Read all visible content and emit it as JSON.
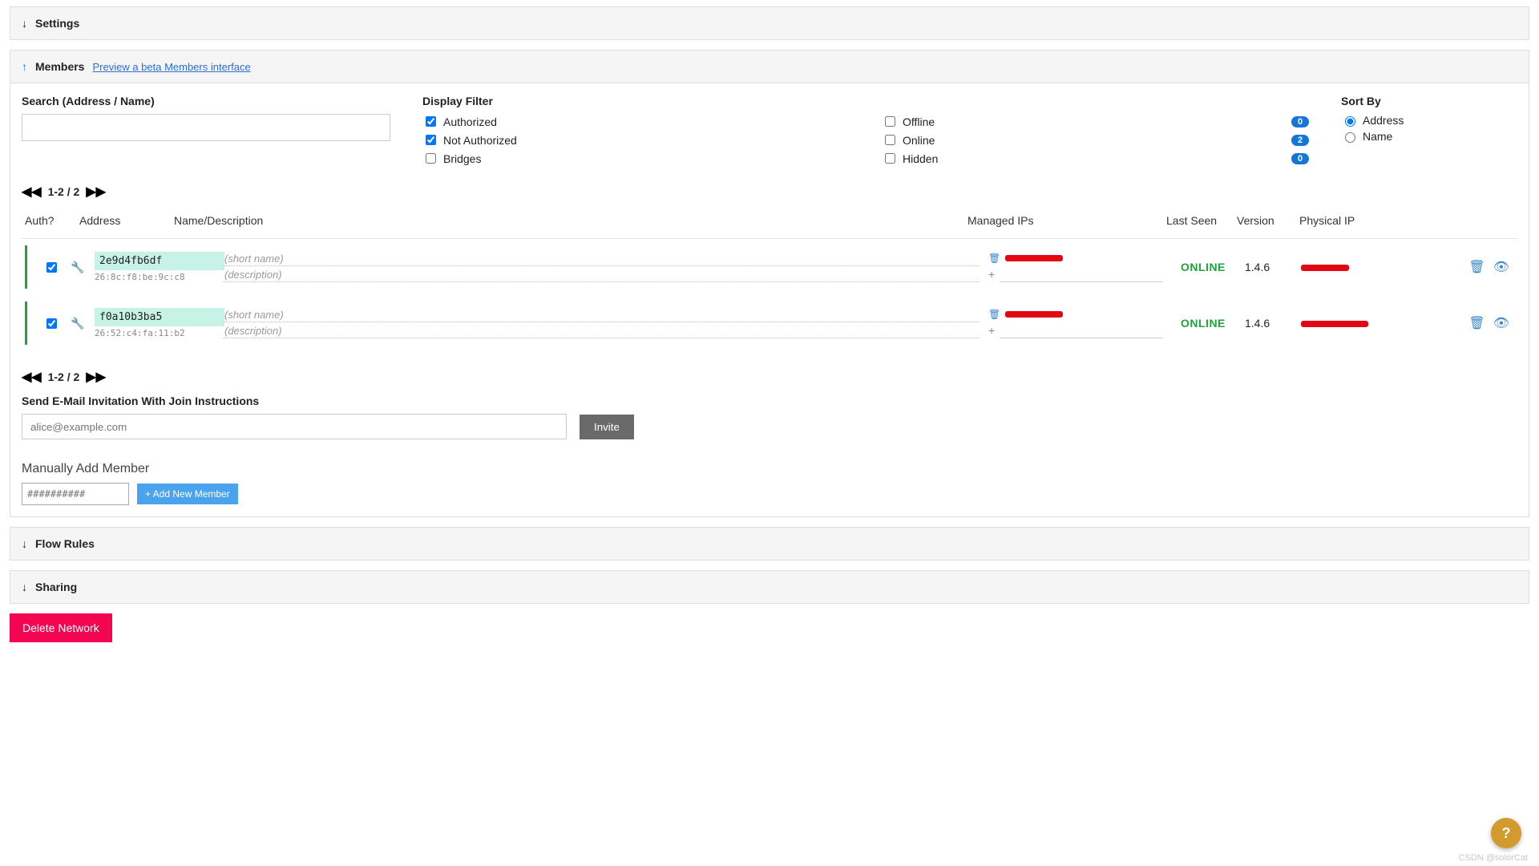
{
  "settings": {
    "title": "Settings"
  },
  "members": {
    "title": "Members",
    "betaLink": "Preview a beta Members interface",
    "searchLabel": "Search (Address / Name)",
    "displayLabel": "Display Filter",
    "sortLabel": "Sort By",
    "display": {
      "authorized": "Authorized",
      "notAuthorized": "Not Authorized",
      "bridges": "Bridges",
      "offline": "Offline",
      "online": "Online",
      "hidden": "Hidden",
      "offlineCount": "0",
      "onlineCount": "2",
      "hiddenCount": "0"
    },
    "sort": {
      "address": "Address",
      "name": "Name"
    },
    "pageRange": "1-2 / 2",
    "headers": {
      "auth": "Auth?",
      "address": "Address",
      "name": "Name/Description",
      "managed": "Managed IPs",
      "lastSeen": "Last Seen",
      "version": "Version",
      "physical": "Physical IP"
    },
    "rows": [
      {
        "address": "2e9d4fb6df",
        "subaddr": "26:8c:f8:be:9c:c8",
        "namePh": "(short name)",
        "descPh": "(description)",
        "lastSeen": "ONLINE",
        "version": "1.4.6"
      },
      {
        "address": "f0a10b3ba5",
        "subaddr": "26:52:c4:fa:11:b2",
        "namePh": "(short name)",
        "descPh": "(description)",
        "lastSeen": "ONLINE",
        "version": "1.4.6"
      }
    ],
    "inviteLabel": "Send E-Mail Invitation With Join Instructions",
    "invitePh": "alice@example.com",
    "inviteBtn": "Invite",
    "manualLabel": "Manually Add Member",
    "manualPh": "##########",
    "manualBtn": "+ Add New Member"
  },
  "flow": {
    "title": "Flow Rules"
  },
  "sharing": {
    "title": "Sharing"
  },
  "deleteBtn": "Delete Network",
  "watermark": "CSDN @solorCat"
}
